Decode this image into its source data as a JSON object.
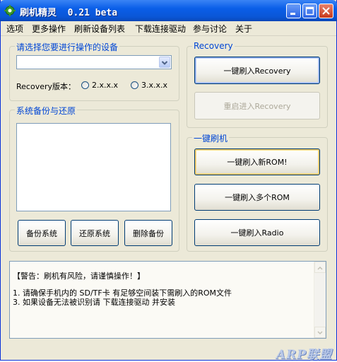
{
  "window": {
    "title": "刷机精灵  0.21 beta"
  },
  "menu": [
    "选项",
    "更多操作",
    "刷新设备列表",
    "下载连接驱动",
    "参与讨论",
    "关于"
  ],
  "device_group": {
    "title": "请选择您要进行操作的设备",
    "device_value": "",
    "recovery_label": "Recovery版本：",
    "option_a": "2.x.x.x",
    "option_b": "3.x.x.x"
  },
  "backup_group": {
    "title": "系统备份与还原",
    "backup_button": "备份系统",
    "restore_button": "还原系统",
    "delete_button": "删除备份"
  },
  "recovery_group": {
    "title": "Recovery",
    "flash_recovery_button": "一键刷入Recovery",
    "reboot_recovery_button": "重启进入Recovery"
  },
  "flash_group": {
    "title": "一键刷机",
    "flash_new_rom_button": "一键刷入新ROM!",
    "flash_multi_rom_button": "一键刷入多个ROM",
    "flash_radio_button": "一键刷入Radio"
  },
  "log": {
    "warning": "【警告：刷机有风险，请谨慎操作！】",
    "line1": "1. 请确保手机内的 SD/TF卡 有足够空间装下需刷入的ROM文件",
    "line2": "3. 如果设备无法被识别请 下载连接驱动 并安装"
  },
  "status": {
    "watermark": "ARP联盟"
  },
  "colors": {
    "group_title": "#0046d5",
    "titlebar": "#0a5ee8",
    "face": "#ece9d8"
  }
}
